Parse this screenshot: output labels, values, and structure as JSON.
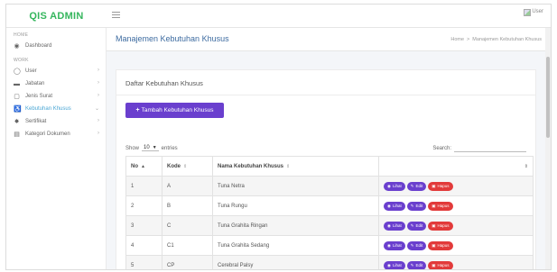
{
  "brand": "QIS ADMIN",
  "user_image_alt": "User",
  "sidebar": {
    "sections": [
      {
        "heading": "HOME",
        "items": [
          {
            "label": "Dashboard",
            "icon": "dashboard-icon",
            "has_chevron": false
          }
        ]
      },
      {
        "heading": "WORK",
        "items": [
          {
            "label": "User",
            "icon": "user-icon",
            "has_chevron": true
          },
          {
            "label": "Jabatan",
            "icon": "briefcase-icon",
            "has_chevron": true
          },
          {
            "label": "Jenis Surat",
            "icon": "file-icon",
            "has_chevron": true
          },
          {
            "label": "Kebutuhan Khusus",
            "icon": "accessibility-icon",
            "has_chevron": true,
            "active": true
          },
          {
            "label": "Sertifikat",
            "icon": "certificate-icon",
            "has_chevron": true
          },
          {
            "label": "Kategori Dokumen",
            "icon": "document-icon",
            "has_chevron": true
          }
        ]
      }
    ]
  },
  "page": {
    "title": "Manajemen Kebutuhan Khusus",
    "breadcrumb": [
      "Home",
      "Manajemen Kebutuhan Khusus"
    ]
  },
  "card": {
    "title": "Daftar Kebutuhan Khusus",
    "add_button": "Tambah Kebutuhan Khusus",
    "show_label": "Show",
    "entries_value": "10",
    "entries_label": "entries",
    "search_label": "Search:"
  },
  "table": {
    "headers": [
      "No",
      "Kode",
      "Nama Kebutuhan Khusus",
      ""
    ],
    "rows": [
      {
        "no": "1",
        "kode": "A",
        "nama": "Tuna Netra"
      },
      {
        "no": "2",
        "kode": "B",
        "nama": "Tuna Rungu"
      },
      {
        "no": "3",
        "kode": "C",
        "nama": "Tuna Grahita Ringan"
      },
      {
        "no": "4",
        "kode": "C1",
        "nama": "Tuna Grahita Sedang"
      },
      {
        "no": "5",
        "kode": "CP",
        "nama": "Cerebral Palsy"
      }
    ],
    "actions": {
      "view": "Lihat",
      "edit": "Edit",
      "delete": "Hapus"
    }
  },
  "colors": {
    "brand": "#35b65d",
    "primary": "#6a3fce",
    "danger": "#e23a3a",
    "active_nav": "#4aa6d4"
  }
}
